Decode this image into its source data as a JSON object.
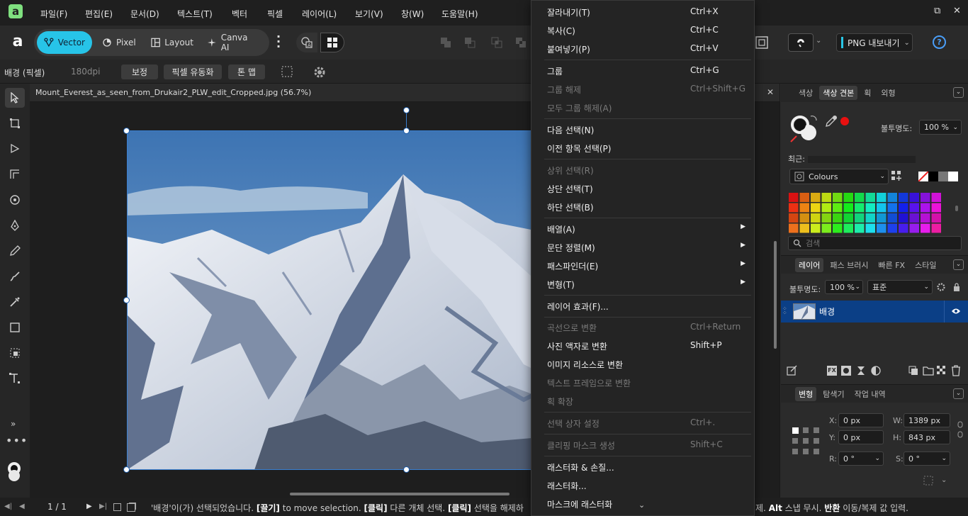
{
  "app": {
    "logo": "a"
  },
  "menubar": {
    "items": [
      "파일(F)",
      "편집(E)",
      "문서(D)",
      "텍스트(T)",
      "벡터",
      "픽셀",
      "레이어(L)",
      "보기(V)",
      "창(W)",
      "도움말(H)"
    ],
    "win_restore": "⧉",
    "win_close": "✕"
  },
  "toolbar": {
    "personas": [
      {
        "label": "Vector",
        "icon": "vector-persona-icon",
        "active": true
      },
      {
        "label": "Pixel",
        "icon": "pixel-persona-icon",
        "active": false
      },
      {
        "label": "Layout",
        "icon": "layout-persona-icon",
        "active": false
      },
      {
        "label": "Canva AI",
        "icon": "canva-ai-icon",
        "active": false
      }
    ],
    "export_label": "PNG 내보내기",
    "help": "?"
  },
  "context_bar": {
    "layer_type": "배경 (픽셀)",
    "dpi": "180dpi",
    "buttons": [
      "보정",
      "픽셀 유동화",
      "톤 맵"
    ]
  },
  "document": {
    "tab_title": "Mount_Everest_as_seen_from_Drukair2_PLW_edit_Cropped.jpg (56.7%)",
    "close": "✕"
  },
  "context_menu": {
    "items": [
      {
        "label": "잘라내기(T)",
        "shortcut": "Ctrl+X",
        "enabled": true
      },
      {
        "label": "복사(C)",
        "shortcut": "Ctrl+C",
        "enabled": true
      },
      {
        "label": "붙여넣기(P)",
        "shortcut": "Ctrl+V",
        "enabled": true
      },
      {
        "sep": true
      },
      {
        "label": "그룹",
        "shortcut": "Ctrl+G",
        "enabled": true
      },
      {
        "label": "그룹 해제",
        "shortcut": "Ctrl+Shift+G",
        "enabled": false
      },
      {
        "label": "모두 그룹 해제(A)",
        "shortcut": "",
        "enabled": false
      },
      {
        "sep": true
      },
      {
        "label": "다음 선택(N)",
        "shortcut": "",
        "enabled": true
      },
      {
        "label": "이전 항목 선택(P)",
        "shortcut": "",
        "enabled": true
      },
      {
        "sep": true
      },
      {
        "label": "상위 선택(R)",
        "shortcut": "",
        "enabled": false
      },
      {
        "label": "상단 선택(T)",
        "shortcut": "",
        "enabled": true
      },
      {
        "label": "하단 선택(B)",
        "shortcut": "",
        "enabled": true
      },
      {
        "sep": true
      },
      {
        "label": "배열(A)",
        "shortcut": "",
        "enabled": true,
        "submenu": true
      },
      {
        "label": "문단 정렬(M)",
        "shortcut": "",
        "enabled": true,
        "submenu": true
      },
      {
        "label": "패스파인더(E)",
        "shortcut": "",
        "enabled": true,
        "submenu": true
      },
      {
        "label": "변형(T)",
        "shortcut": "",
        "enabled": true,
        "submenu": true
      },
      {
        "sep": true
      },
      {
        "label": "레이어 효과(F)...",
        "shortcut": "",
        "enabled": true
      },
      {
        "sep": true
      },
      {
        "label": "곡선으로 변환",
        "shortcut": "Ctrl+Return",
        "enabled": false
      },
      {
        "label": "사진 액자로 변환",
        "shortcut": "Shift+P",
        "enabled": true
      },
      {
        "label": "이미지 리소스로 변환",
        "shortcut": "",
        "enabled": true
      },
      {
        "label": "텍스트 프레임으로 변환",
        "shortcut": "",
        "enabled": false
      },
      {
        "label": "획 확장",
        "shortcut": "",
        "enabled": false
      },
      {
        "sep": true
      },
      {
        "label": "선택 상자 설정",
        "shortcut": "Ctrl+.",
        "enabled": false
      },
      {
        "sep": true
      },
      {
        "label": "클리핑 마스크 생성",
        "shortcut": "Shift+C",
        "enabled": false
      },
      {
        "sep": true
      },
      {
        "label": "래스터화 & 손질...",
        "shortcut": "",
        "enabled": true
      },
      {
        "label": "래스터화...",
        "shortcut": "",
        "enabled": true
      },
      {
        "label": "마스크에 래스터화",
        "shortcut": "",
        "enabled": true
      }
    ],
    "scroll_down": "⌄"
  },
  "color_panel": {
    "tabs": [
      "색상",
      "색상 견본",
      "획",
      "외형"
    ],
    "active_tab": 1,
    "opacity_label": "불투명도:",
    "opacity_value": "100 %",
    "recent_label": "최근:",
    "palette_name": "Colours",
    "search_placeholder": "검색",
    "accent": "#e81010"
  },
  "layers_panel": {
    "tabs": [
      "레이어",
      "패스 브러시",
      "빠른 FX",
      "스타일"
    ],
    "active_tab": 0,
    "opacity_label": "불투명도:",
    "opacity_value": "100 %",
    "blend_mode": "표준",
    "layers": [
      {
        "name": "배경",
        "selected": true
      }
    ]
  },
  "transform_panel": {
    "tabs": [
      "변형",
      "탐색기",
      "작업 내역"
    ],
    "active_tab": 0,
    "x_label": "X:",
    "x_value": "0 px",
    "y_label": "Y:",
    "y_value": "0 px",
    "w_label": "W:",
    "w_value": "1389 px",
    "h_label": "H:",
    "h_value": "843 px",
    "r_label": "R:",
    "r_value": "0 °",
    "s_label": "S:",
    "s_value": "0 °"
  },
  "statusbar": {
    "page": "1 / 1",
    "message_prefix": "'배경'이(가) 선택되었습니다.",
    "drag_key": "[끌기]",
    "drag_text": "to move selection.",
    "click_key": "[클릭]",
    "click_text": "다른 개체 선택.",
    "click2_key": "[클릭]",
    "click2_text": "선택을 해제하",
    "right_text": "제.",
    "alt_key": "Alt",
    "alt_text": "스냅 무시.",
    "turn_key": "반환",
    "turn_text": "이동/복제 값 입력."
  }
}
